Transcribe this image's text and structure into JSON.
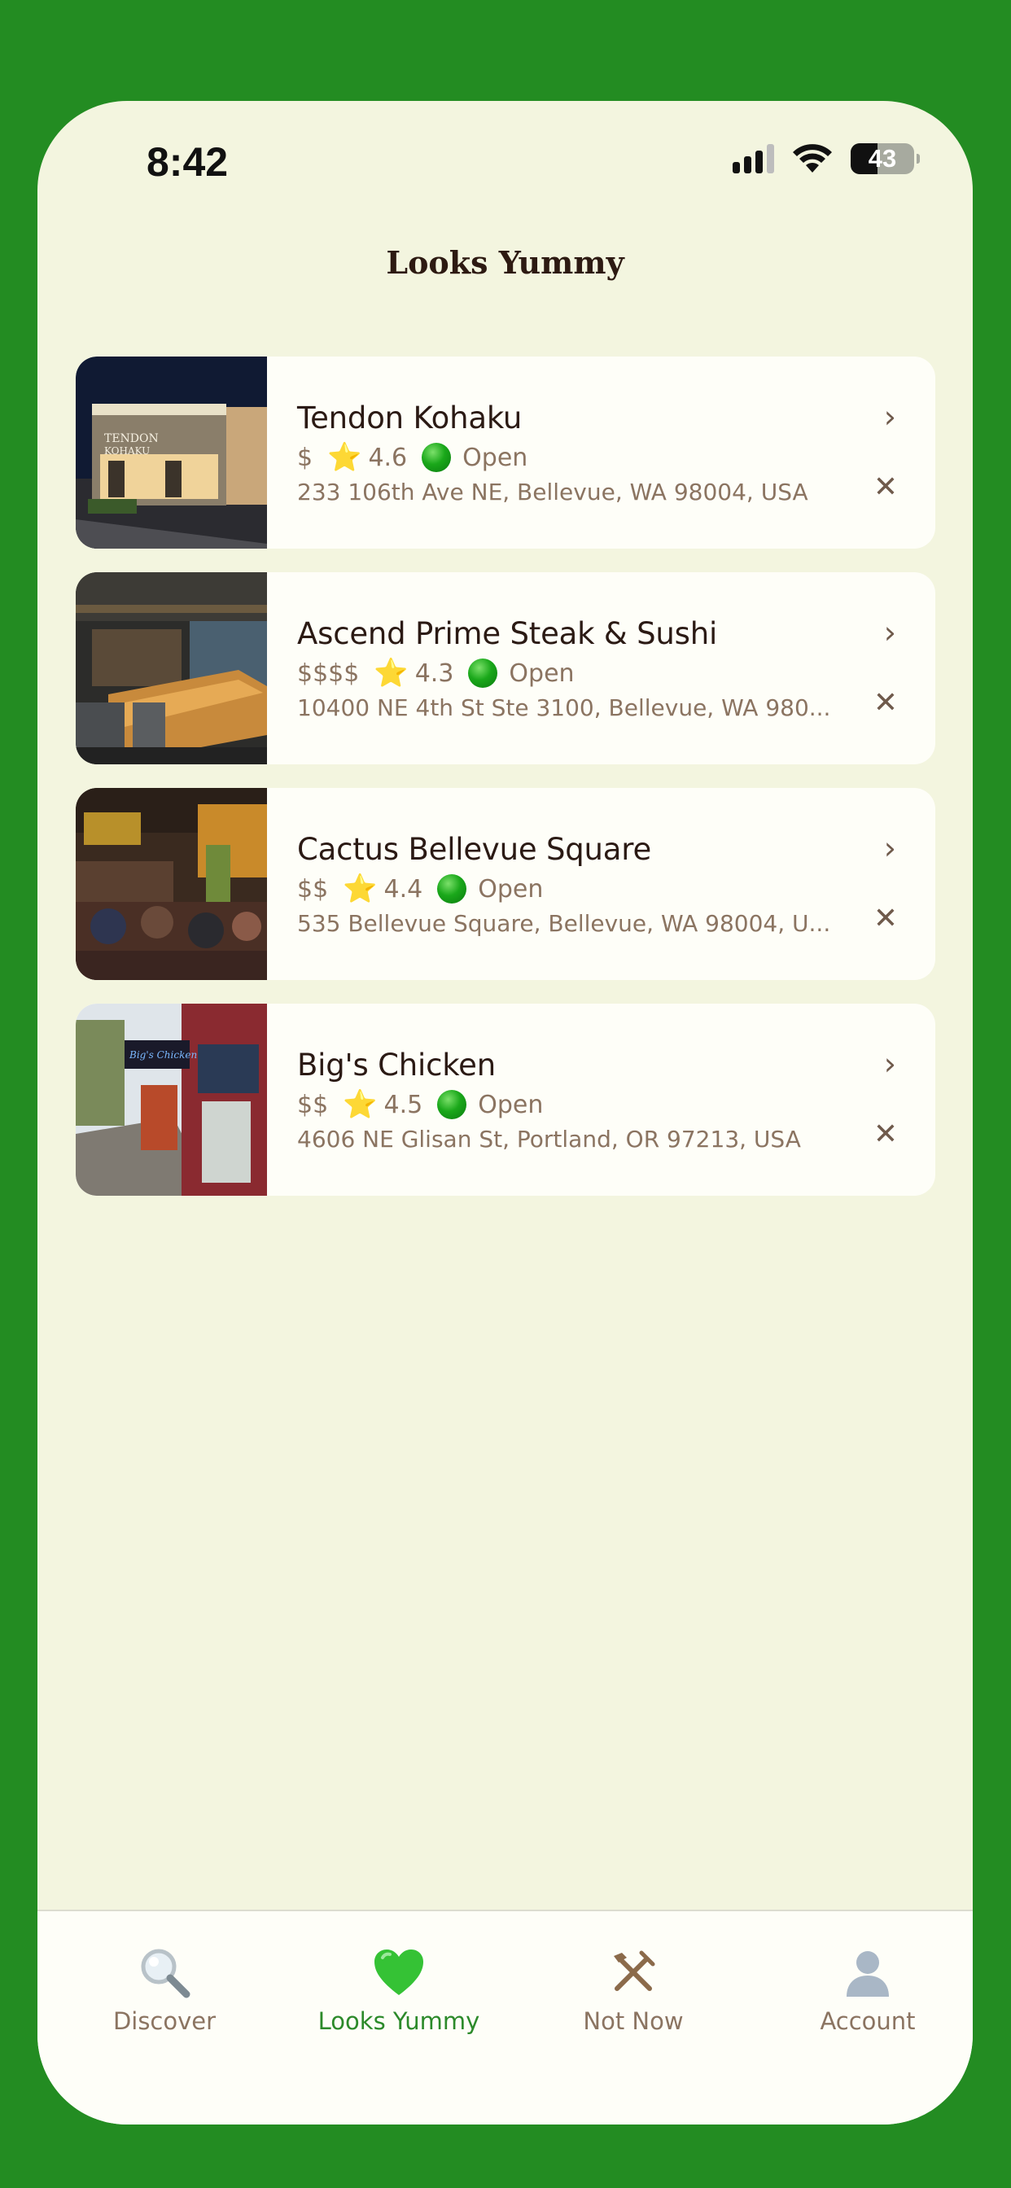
{
  "status_bar": {
    "time": "8:42",
    "battery": "43"
  },
  "header": {
    "title": "Looks Yummy"
  },
  "restaurants": [
    {
      "name": "Tendon Kohaku",
      "price": "$",
      "rating": "4.6",
      "status": "Open",
      "address": "233 106th Ave NE, Bellevue, WA 98004, USA"
    },
    {
      "name": "Ascend Prime Steak & Sushi",
      "price": "$$$$",
      "rating": "4.3",
      "status": "Open",
      "address": "10400 NE 4th St Ste 3100, Bellevue, WA 980..."
    },
    {
      "name": "Cactus Bellevue Square",
      "price": "$$",
      "rating": "4.4",
      "status": "Open",
      "address": "535 Bellevue Square, Bellevue, WA 98004, U..."
    },
    {
      "name": "Big's Chicken",
      "price": "$$",
      "rating": "4.5",
      "status": "Open",
      "address": "4606 NE Glisan St, Portland, OR 97213, USA"
    }
  ],
  "tabs": [
    {
      "label": "Discover",
      "icon": "magnifier-icon"
    },
    {
      "label": "Looks Yummy",
      "icon": "green-heart-icon",
      "active": true
    },
    {
      "label": "Not Now",
      "icon": "crossed-utensils-icon"
    },
    {
      "label": "Account",
      "icon": "user-silhouette-icon"
    }
  ],
  "colors": {
    "background": "#238c22",
    "screen": "#f3f5df",
    "card": "#fefef8",
    "accent": "#2c8a2a",
    "muted_text": "#8b7461"
  }
}
